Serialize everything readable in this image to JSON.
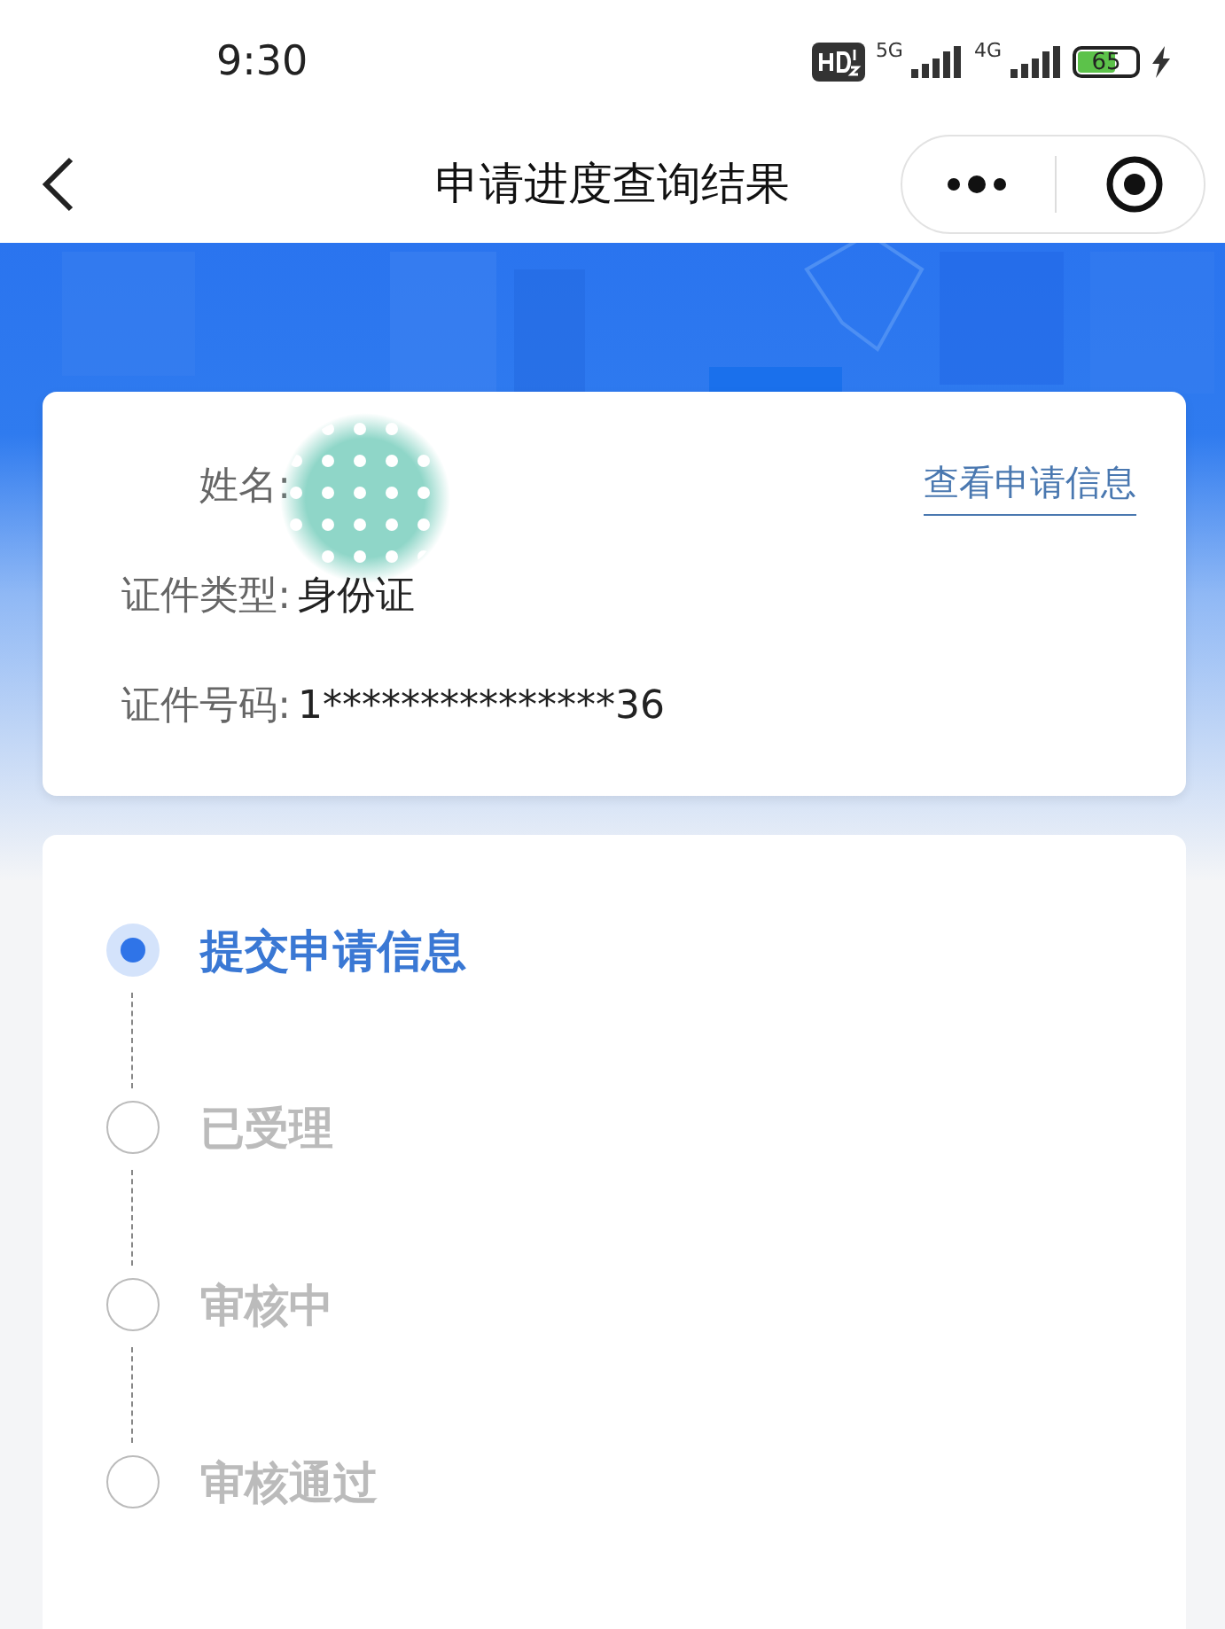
{
  "status_bar": {
    "time": "9:30",
    "signals": [
      {
        "label": "5G"
      },
      {
        "label": "4G"
      }
    ],
    "battery": {
      "level": 0.65,
      "reading": "65"
    }
  },
  "nav": {
    "title": "申请进度查询结果"
  },
  "info": {
    "link": "查看申请信息",
    "fields": [
      {
        "label": "姓名:",
        "masked": true
      },
      {
        "label": "证件类型:",
        "value": "身份证"
      },
      {
        "label": "证件号码:",
        "value": "1***************36"
      }
    ]
  },
  "steps": [
    {
      "label": "提交申请信息",
      "selected": true
    },
    {
      "label": "已受理",
      "selected": false
    },
    {
      "label": "审核中",
      "selected": false
    },
    {
      "label": "审核通过",
      "selected": false
    }
  ]
}
